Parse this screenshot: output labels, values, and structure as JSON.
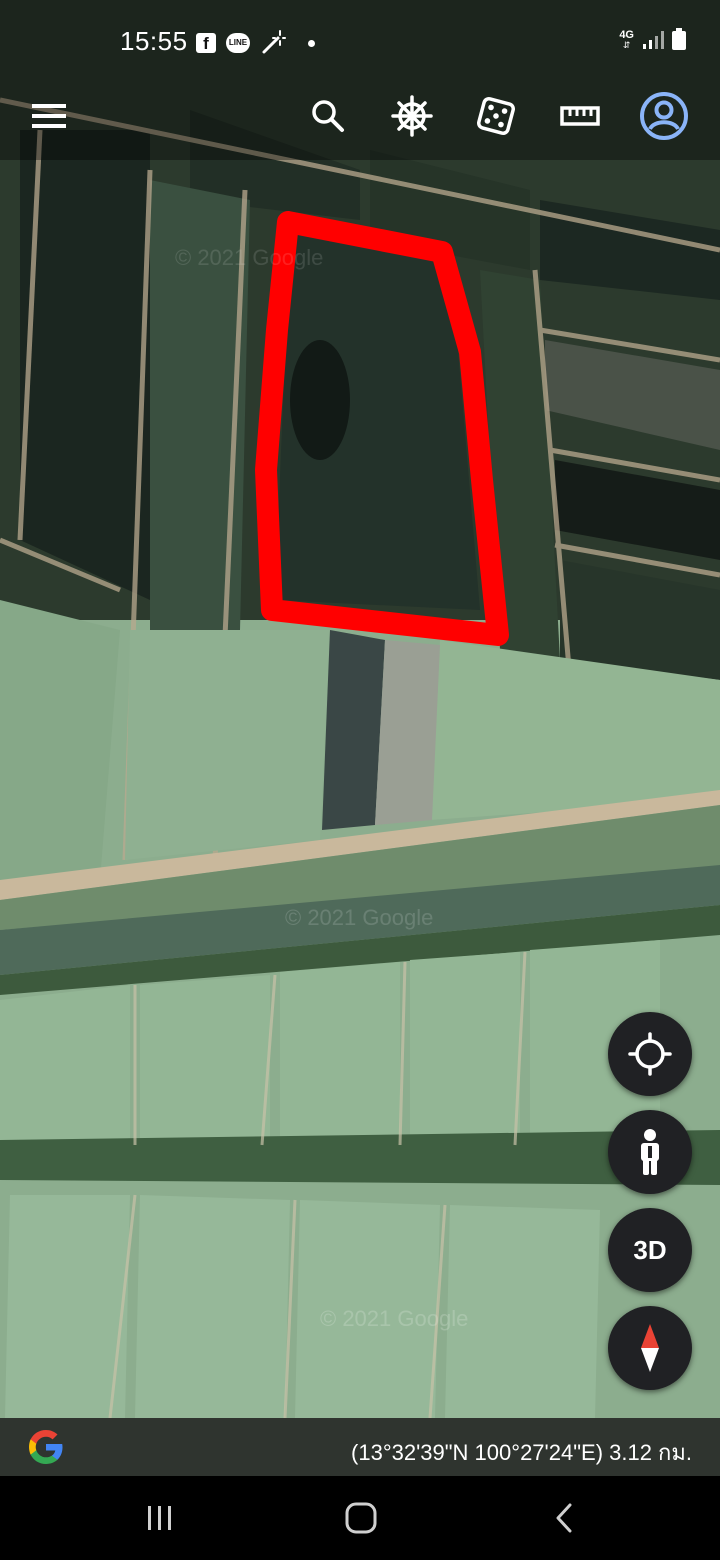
{
  "status_bar": {
    "time": "15:55",
    "left_icons": [
      "facebook-icon",
      "line-icon",
      "magic-wand-icon",
      "notification-dot-icon"
    ],
    "fb_glyph": "f",
    "line_glyph": "LINE",
    "network": "4G",
    "right_icons": [
      "signal-icon",
      "battery-icon"
    ]
  },
  "toolbar": {
    "items": [
      "menu-icon",
      "search-icon",
      "voyager-wheel-icon",
      "random-dice-icon",
      "measure-ruler-icon",
      "account-icon"
    ]
  },
  "map": {
    "type": "satellite",
    "watermark": "© 2021 Google",
    "annotation_color": "#ff0000"
  },
  "fabs": {
    "locate": "my-location-icon",
    "pegman": "pegman-icon",
    "three_d": "3D",
    "compass": "compass-icon"
  },
  "info_bar": {
    "logo": "google-g-logo",
    "coordinates": "(13°32'39\"N 100°27'24\"E) 3.12 กม."
  },
  "nav_bar": {
    "items": [
      "recent-apps-icon",
      "home-icon",
      "back-icon"
    ]
  },
  "colors": {
    "accent": "#8ab4f8",
    "fab_bg": "#202124",
    "outline": "#ff0000"
  }
}
